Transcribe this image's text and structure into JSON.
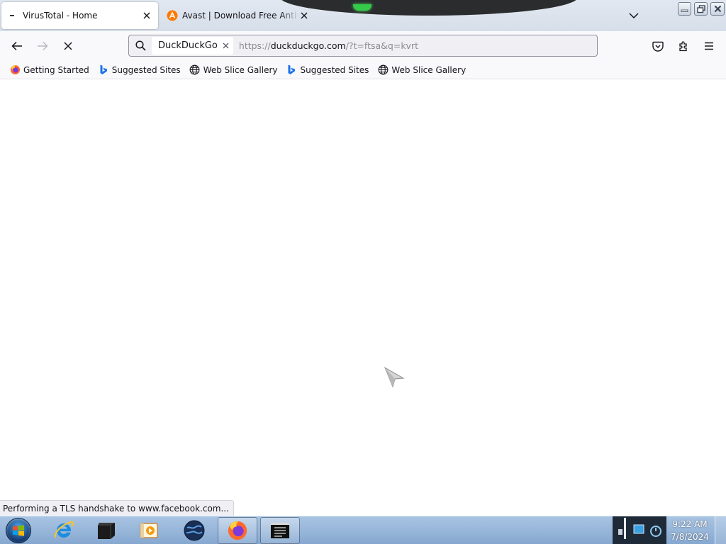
{
  "browser": {
    "tabs": [
      {
        "title": "VirusTotal - Home",
        "active": true
      },
      {
        "title": "Avast | Download Free Antivirus",
        "active": false
      }
    ],
    "url_bar": {
      "search_engine": "DuckDuckGo",
      "url_scheme": "https://",
      "url_host": "duckduckgo.com",
      "url_path": "/?t=ftsa&q=kvrt"
    },
    "bookmarks": [
      {
        "label": "Getting Started",
        "icon": "firefox-icon"
      },
      {
        "label": "Suggested Sites",
        "icon": "bing-icon"
      },
      {
        "label": "Web Slice Gallery",
        "icon": "globe-icon"
      },
      {
        "label": "Suggested Sites",
        "icon": "bing-icon"
      },
      {
        "label": "Web Slice Gallery",
        "icon": "globe-icon"
      }
    ],
    "status_text": "Performing a TLS handshake to www.facebook.com..."
  },
  "taskbar": {
    "clock_time": "9:22 AM",
    "clock_date": "7/8/2024",
    "items": [
      "internet-explorer-icon",
      "cmd-window-icon",
      "media-player-icon",
      "globe-app-icon",
      "firefox-icon",
      "terminal-icon"
    ]
  },
  "colors": {
    "accent": "#0061e0",
    "taskbar": "#9bb8db",
    "avast": "#ff7800"
  }
}
